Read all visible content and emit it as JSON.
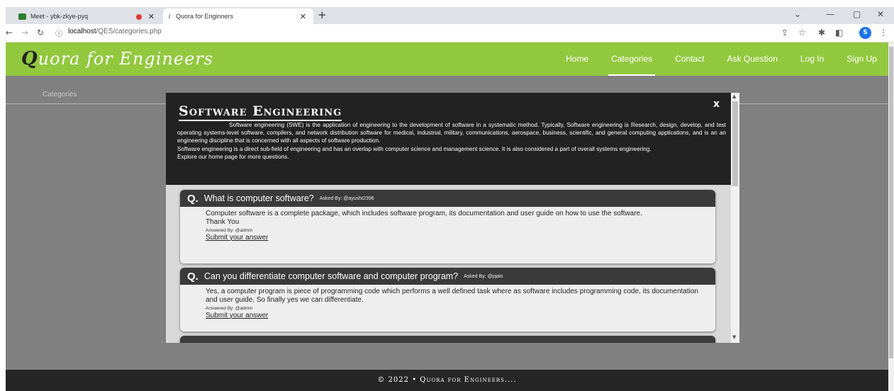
{
  "browser": {
    "tabs": [
      {
        "title": "Meet - ybk-zkye-pyq"
      },
      {
        "title": "Quora for Enginners"
      }
    ],
    "url_host": "localhost",
    "url_path": "/QES/categories.php",
    "profile_initial": "S"
  },
  "site": {
    "brand_initial": "Q",
    "brand_rest": "uora for Engineers",
    "nav": [
      {
        "label": "Home"
      },
      {
        "label": "Categories"
      },
      {
        "label": "Contact"
      },
      {
        "label": "Ask Question"
      },
      {
        "label": "Log In"
      },
      {
        "label": "Sign Up"
      }
    ],
    "active_nav": "Categories",
    "section_label": "Categories",
    "footer": "© 2022 • Quora for Engineers...."
  },
  "modal": {
    "title": "Software Engineering",
    "close": "x",
    "description": [
      "Software engineering (SWE) is the application of engineering to the development of software in a systematic method. Typically, Software engineering is Research, design, develop, and test operating systems-level software, compilers, and network distribution software for medical, industrial, military, communications, aerospace, business, scientific, and general computing applications, and is an an engineering discipline that is concerned with all aspects of software production.",
      "Software engineering is a direct sub-field of engineering and has an overlap with computer science and management science. It is also considered a part of overall systems engineering.",
      "Explore our home page for more questions."
    ],
    "questions": [
      {
        "q": "What is computer software?",
        "asked_by": "Asked By: @ayusht2396",
        "answer": "Computer software is a complete package, which includes software program, its documentation and user guide on how to use the software.",
        "answer_extra": "Thank You",
        "answered_by": "Answered By: @admin",
        "submit": "Submit your answer"
      },
      {
        "q": "Can you differentiate computer software and computer program?",
        "asked_by": "Asked By: @pjain",
        "answer": "Yes, a computer program is piece of programming code which performs a well defined task where as software includes programming code, its documentation and user guide. So finally yes we can differentiate.",
        "answer_extra": "",
        "answered_by": "Answered By: @admin",
        "submit": "Submit your answer"
      }
    ]
  }
}
